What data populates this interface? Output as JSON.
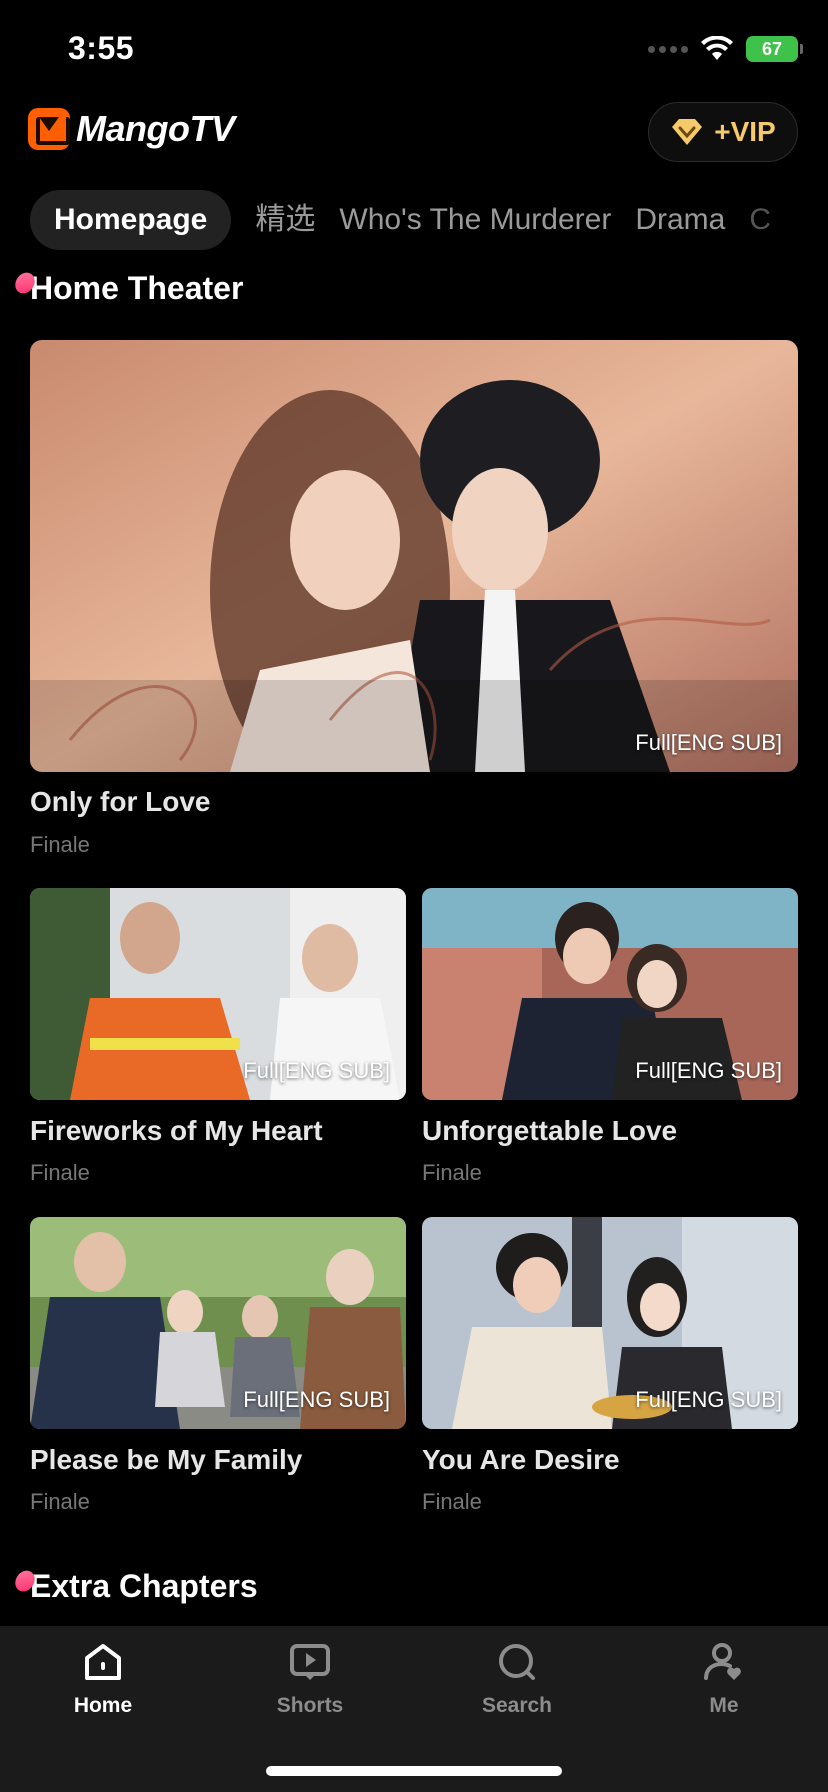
{
  "status_bar": {
    "time": "3:55",
    "battery": "67"
  },
  "header": {
    "logo_text": "MangoTV",
    "vip_label": "+VIP"
  },
  "tabs": [
    {
      "label": "Homepage",
      "active": true
    },
    {
      "label": "精选"
    },
    {
      "label": "Who's The Murderer"
    },
    {
      "label": "Drama"
    },
    {
      "label": "C"
    }
  ],
  "sections": {
    "home_theater": "Home Theater",
    "extra_chapters": "Extra Chapters"
  },
  "hero": {
    "title": "Only for Love",
    "subtitle": "Finale",
    "tag": "Full[ENG SUB]"
  },
  "grid": [
    {
      "title": "Fireworks of My Heart",
      "subtitle": "Finale",
      "tag": "Full[ENG SUB]"
    },
    {
      "title": "Unforgettable Love",
      "subtitle": "Finale",
      "tag": "Full[ENG SUB]"
    },
    {
      "title": "Please be My Family",
      "subtitle": "Finale",
      "tag": "Full[ENG SUB]"
    },
    {
      "title": "You Are Desire",
      "subtitle": "Finale",
      "tag": "Full[ENG SUB]"
    }
  ],
  "bottom_nav": [
    {
      "label": "Home",
      "icon": "home-icon",
      "active": true
    },
    {
      "label": "Shorts",
      "icon": "play-icon"
    },
    {
      "label": "Search",
      "icon": "search-icon"
    },
    {
      "label": "Me",
      "icon": "profile-icon"
    }
  ],
  "colors": {
    "accent": "#ff5f00",
    "vip_gold": "#f6c96a",
    "background": "#000000",
    "nav_background": "#1b1b1b"
  }
}
